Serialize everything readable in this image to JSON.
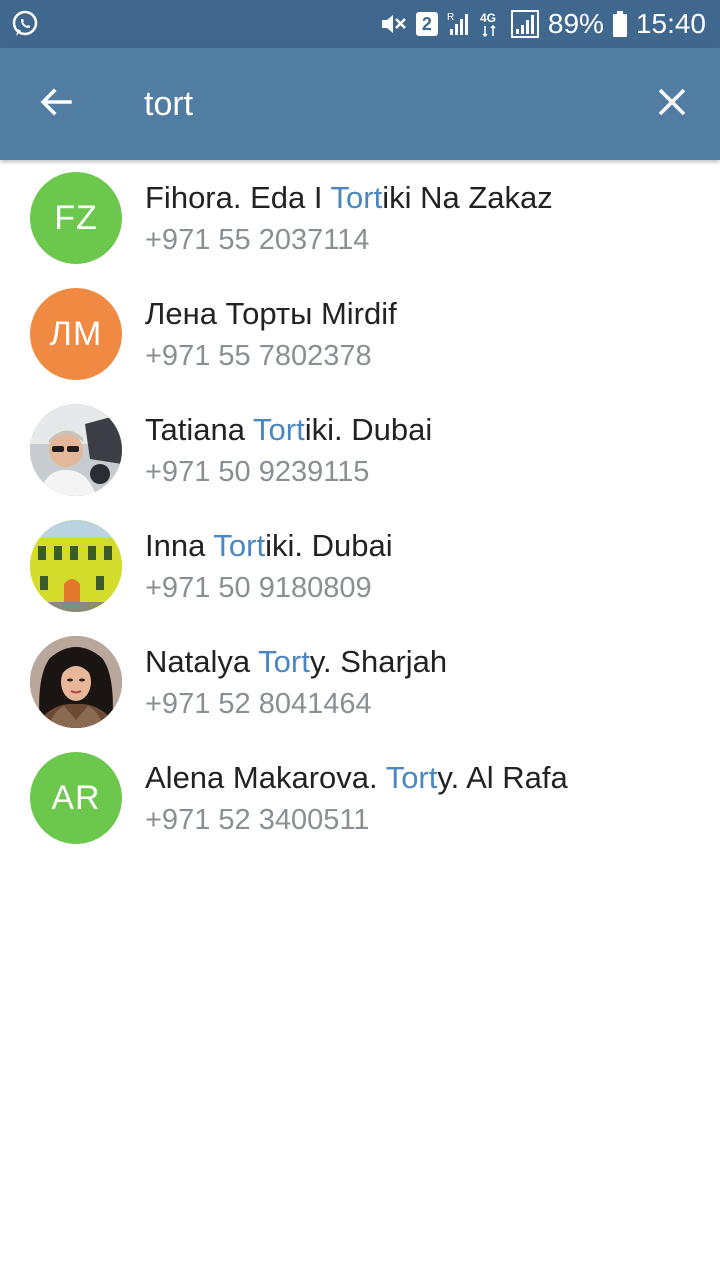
{
  "status_bar": {
    "sim_slot": "2",
    "network": "4G",
    "battery": "89%",
    "time": "15:40",
    "icons": [
      "whatsapp-icon",
      "mute-icon",
      "sim-icon",
      "roaming-signal-icon",
      "4g-icon",
      "signal-icon",
      "battery-icon"
    ]
  },
  "toolbar": {
    "search_value": "tort",
    "back_icon": "arrow-back-icon",
    "clear_icon": "close-icon",
    "background": "#527da3"
  },
  "highlight_color": "#4a87c2",
  "contacts": [
    {
      "name_pre": "Fihora. Eda I ",
      "name_match": "Tort",
      "name_post": "iki Na Zakaz",
      "phone": "+971 55 2037114",
      "initials": "FZ",
      "avatar_color": "#6cc74d"
    },
    {
      "name_pre": "Лена Торты Mirdif",
      "name_match": "",
      "name_post": "",
      "phone": "+971 55 7802378",
      "initials": "ЛМ",
      "avatar_color": "#f08a43"
    },
    {
      "name_pre": "Tatiana ",
      "name_match": "Tort",
      "name_post": "iki. Dubai",
      "phone": "+971 50 9239115",
      "initials": "",
      "avatar_color": "#9aa3ab"
    },
    {
      "name_pre": "Inna ",
      "name_match": "Tort",
      "name_post": "iki. Dubai",
      "phone": "+971 50 9180809",
      "initials": "",
      "avatar_color": "#c9d62a"
    },
    {
      "name_pre": "Natalya ",
      "name_match": "Tort",
      "name_post": "y. Sharjah",
      "phone": "+971 52 8041464",
      "initials": "",
      "avatar_color": "#7a5540"
    },
    {
      "name_pre": "Alena Makarova. ",
      "name_match": "Tort",
      "name_post": "y. Al Rafa",
      "phone": "+971 52 3400511",
      "initials": "AR",
      "avatar_color": "#6cc74d"
    }
  ]
}
